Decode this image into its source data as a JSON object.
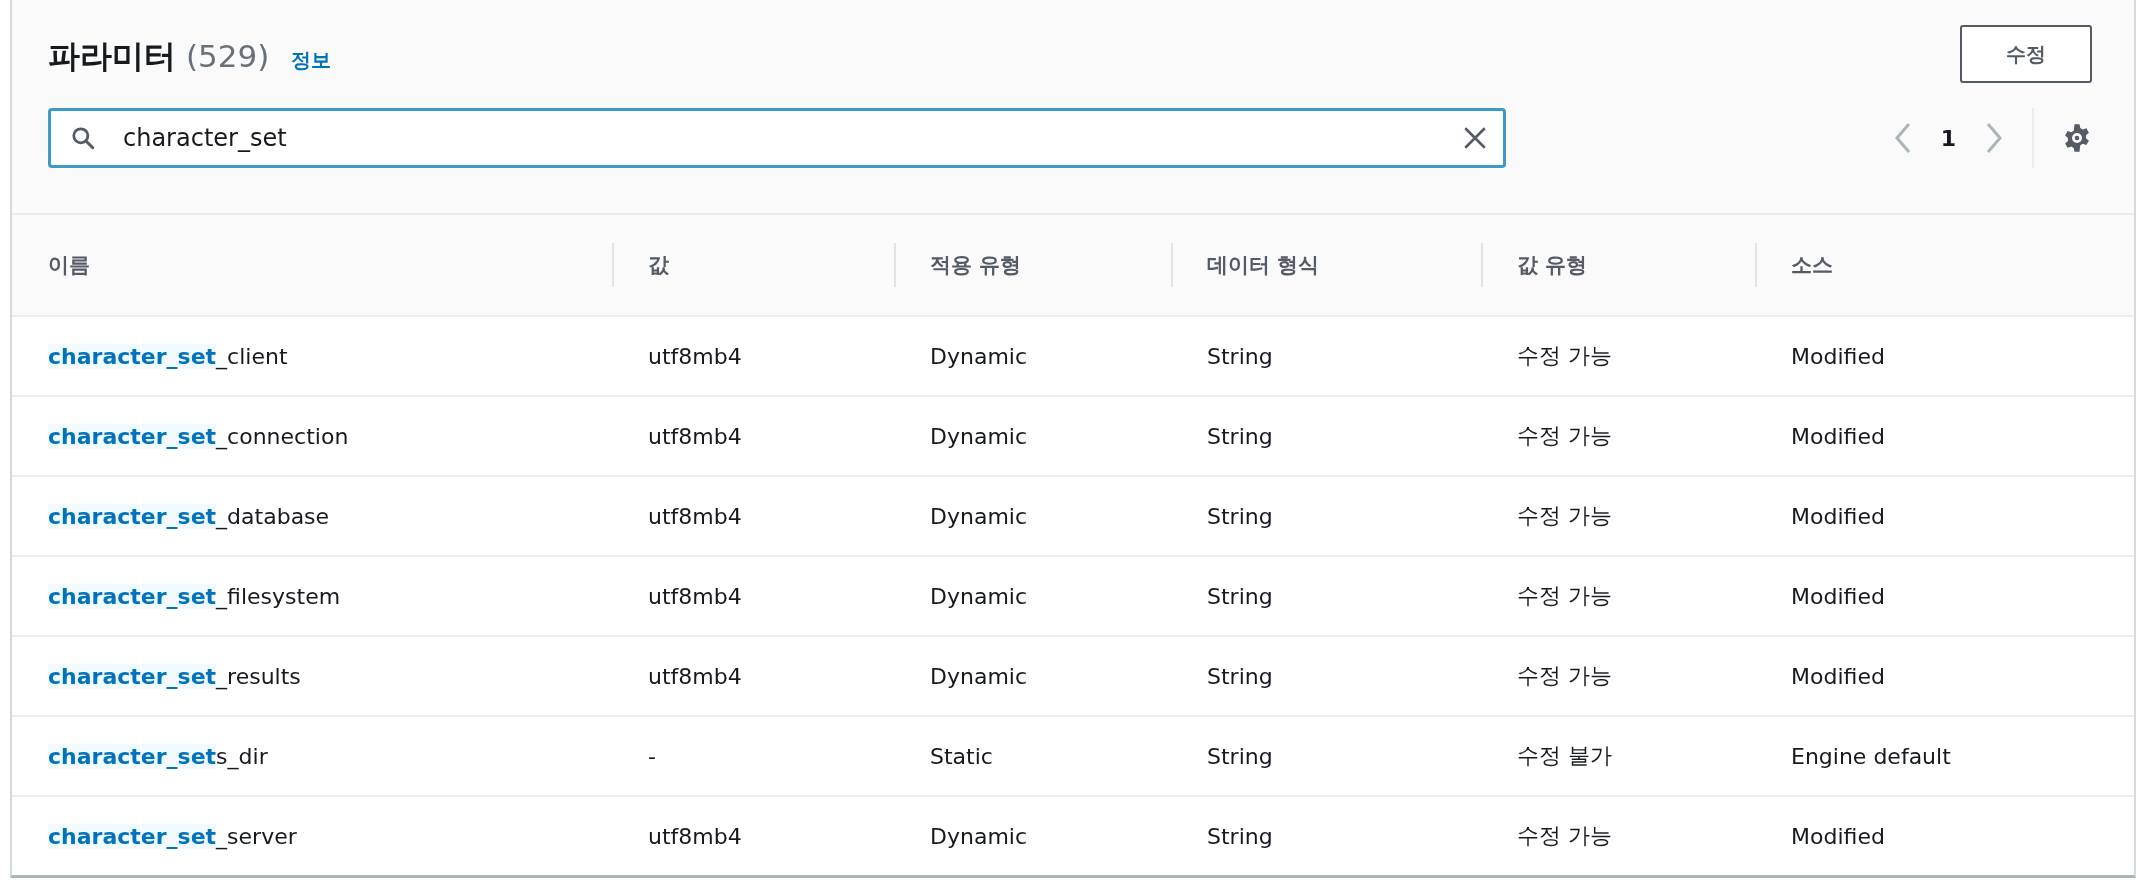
{
  "header": {
    "title": "파라미터",
    "count": "(529)",
    "info_link": "정보",
    "edit_button": "수정"
  },
  "search": {
    "value": "character_set"
  },
  "pagination": {
    "page": "1",
    "previous_disabled": true,
    "next_disabled": true
  },
  "table": {
    "columns": [
      "이름",
      "값",
      "적용 유형",
      "데이터 형식",
      "값 유형",
      "소스"
    ],
    "rows": [
      {
        "name": "**character_set**_client",
        "value": "utf8mb4",
        "apply_type": "Dynamic",
        "data_type": "String",
        "value_type": "수정 가능",
        "source": "Modified"
      },
      {
        "name": "**character_set**_connection",
        "value": "utf8mb4",
        "apply_type": "Dynamic",
        "data_type": "String",
        "value_type": "수정 가능",
        "source": "Modified"
      },
      {
        "name": "**character_set**_database",
        "value": "utf8mb4",
        "apply_type": "Dynamic",
        "data_type": "String",
        "value_type": "수정 가능",
        "source": "Modified"
      },
      {
        "name": "**character_set**_filesystem",
        "value": "utf8mb4",
        "apply_type": "Dynamic",
        "data_type": "String",
        "value_type": "수정 가능",
        "source": "Modified"
      },
      {
        "name": "**character_set**_results",
        "value": "utf8mb4",
        "apply_type": "Dynamic",
        "data_type": "String",
        "value_type": "수정 가능",
        "source": "Modified"
      },
      {
        "name": "**character_set**s_dir",
        "value": "-",
        "apply_type": "Static",
        "data_type": "String",
        "value_type": "수정 불가",
        "source": "Engine default"
      },
      {
        "name": "**character_set**_server",
        "value": "utf8mb4",
        "apply_type": "Dynamic",
        "data_type": "String",
        "value_type": "수정 가능",
        "source": "Modified"
      }
    ]
  }
}
